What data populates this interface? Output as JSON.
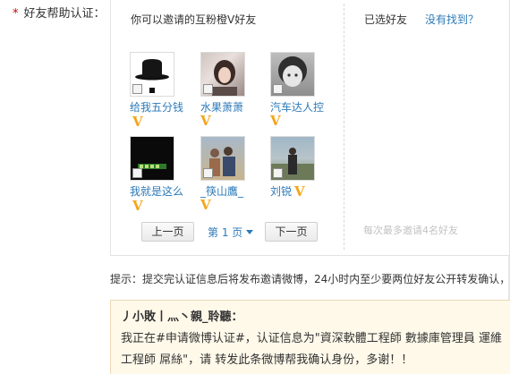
{
  "form": {
    "field_label": "好友帮助认证：",
    "required_mark": "*"
  },
  "picker": {
    "title": "你可以邀请的互粉橙V好友",
    "selected_title": "已选好友",
    "not_found_link": "没有找到？",
    "max_hint": "每次最多邀请4名好友",
    "friends": [
      {
        "name": "给我五分钱",
        "verified": true,
        "avatar": "top-hat-avatar",
        "checked": false
      },
      {
        "name": "水果萧萧",
        "verified": true,
        "avatar": "woman-photo-avatar",
        "checked": false
      },
      {
        "name": "汽车达人控",
        "verified": true,
        "avatar": "child-photo-avatar",
        "checked": false
      },
      {
        "name": "我就是这么",
        "verified": true,
        "avatar": "dark-sign-avatar",
        "checked": false
      },
      {
        "name": "_筷山鷹_",
        "verified": true,
        "avatar": "group-photo-avatar",
        "checked": false
      },
      {
        "name": "刘锐",
        "verified": true,
        "avatar": "outdoor-photo-avatar",
        "checked": false
      }
    ],
    "pagination": {
      "prev_label": "上一页",
      "current_label": "第 1 页",
      "next_label": "下一页"
    }
  },
  "tip": {
    "text": "提示：提交完认证信息后将发布邀请微博，24小时内至少要两位好友公开转发确认，"
  },
  "preview": {
    "name": "丿小敗丨灬丶親_聆聽：",
    "body": "我正在#申请微博认证#，认证信息为\"資深軟體工程師 數據庫管理員 運維工程師 屌絲\"，请 转发此条微博帮我确认身份，多谢！！"
  },
  "colors": {
    "link": "#2d7ab8",
    "verified_badge": "#f3a519",
    "required": "#cc0000",
    "preview_bg": "#fff9ea"
  }
}
